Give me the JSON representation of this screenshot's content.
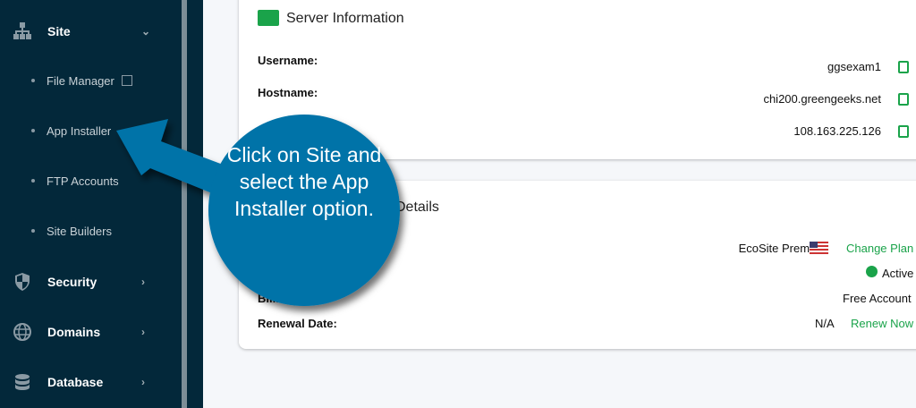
{
  "sidebar": {
    "site": {
      "label": "Site",
      "icon": "sitemap-icon",
      "expanded": true
    },
    "sub_items": [
      {
        "label": "File Manager",
        "icon": "external-link-icon"
      },
      {
        "label": "App Installer"
      },
      {
        "label": "FTP Accounts"
      },
      {
        "label": "Site Builders"
      }
    ],
    "items": [
      {
        "label": "Security",
        "icon": "shield-icon"
      },
      {
        "label": "Domains",
        "icon": "globe-icon"
      },
      {
        "label": "Database",
        "icon": "database-icon"
      }
    ]
  },
  "server_info": {
    "title": "Server Information",
    "rows": [
      {
        "label": "Username:",
        "value": "ggsexam1"
      },
      {
        "label": "Hostname:",
        "value": "chi200.greengeeks.net"
      },
      {
        "label": "",
        "value": "108.163.225.126"
      }
    ]
  },
  "account": {
    "title": "Details",
    "plan": "EcoSite Premium",
    "change_plan": "Change Plan",
    "status": "Active",
    "billing_label": "Billing Cycle:",
    "billing": "Free Account",
    "renewal_label": "Renewal Date:",
    "renewal": "N/A",
    "renew_now": "Renew Now"
  },
  "callout": {
    "text": "Click on Site and select the App Installer option.",
    "color": "#0573a8"
  },
  "colors": {
    "sidebar": "#03283a",
    "accent": "#1aa34a"
  }
}
